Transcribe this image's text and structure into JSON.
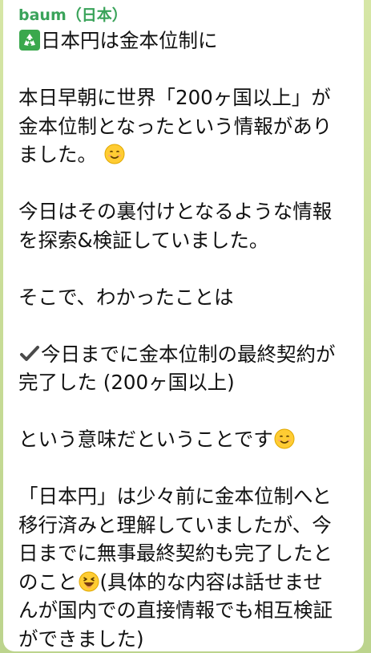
{
  "sender": "baum（日本）",
  "lines": {
    "l1": "日本円は金本位制に",
    "l2": "本日早朝に世界「200ヶ国以上」が",
    "l3": "金本位制となったという情報があり",
    "l4": "ました。",
    "l5": "今日はその裏付けとなるような情報",
    "l6": "を探索&検証していました。",
    "l7": "そこで、わかったことは",
    "l8": "今日までに金本位制の最終契約が",
    "l9": "完了した (200ヶ国以上)",
    "l10": "という意味だということです",
    "l11": "「日本円」は少々前に金本位制へと",
    "l12": "移行済みと理解していましたが、今",
    "l13": "日までに無事最終契約も完了したと",
    "l14a": "のこと",
    "l14b": "(具体的な内容は話せませ",
    "l15": "んが国内での直接情報でも相互検証",
    "l16": "ができました)"
  },
  "icons": {
    "recycle": "recycle-icon",
    "smile": "smiling-face-icon",
    "check": "check-mark-icon",
    "laugh": "laughing-face-icon"
  },
  "colors": {
    "sender": "#3aa35a",
    "background": "#c9dd98",
    "bubble": "#ffffff",
    "text": "#111111"
  }
}
